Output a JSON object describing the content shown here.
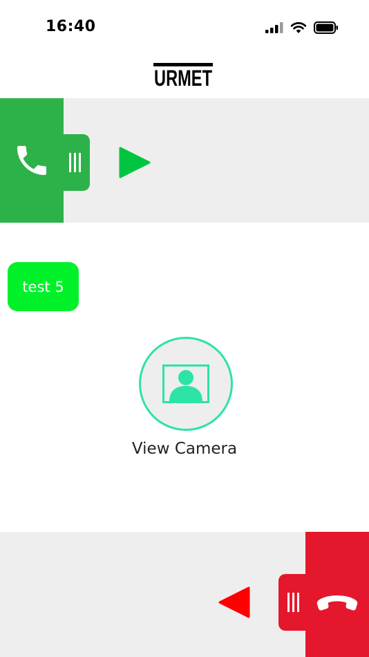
{
  "status_bar": {
    "time": "16:40",
    "icons": [
      "cellular-signal-icon",
      "wifi-icon",
      "battery-icon"
    ]
  },
  "header": {
    "logo_text": "URMET"
  },
  "accept_call": {
    "icons": [
      "phone-icon",
      "grip-icon",
      "play-arrow-icon"
    ],
    "color": "#2db24a",
    "arrow_color": "#00c540"
  },
  "tag": {
    "label": "test 5",
    "color": "#00f12a"
  },
  "camera": {
    "label": "View Camera",
    "icon": "camera-portrait-icon",
    "accent": "#2de3a6"
  },
  "reject_call": {
    "icons": [
      "hangup-icon",
      "grip-icon",
      "arrow-left-icon"
    ],
    "color": "#e5172c",
    "arrow_color": "#ff0000"
  }
}
